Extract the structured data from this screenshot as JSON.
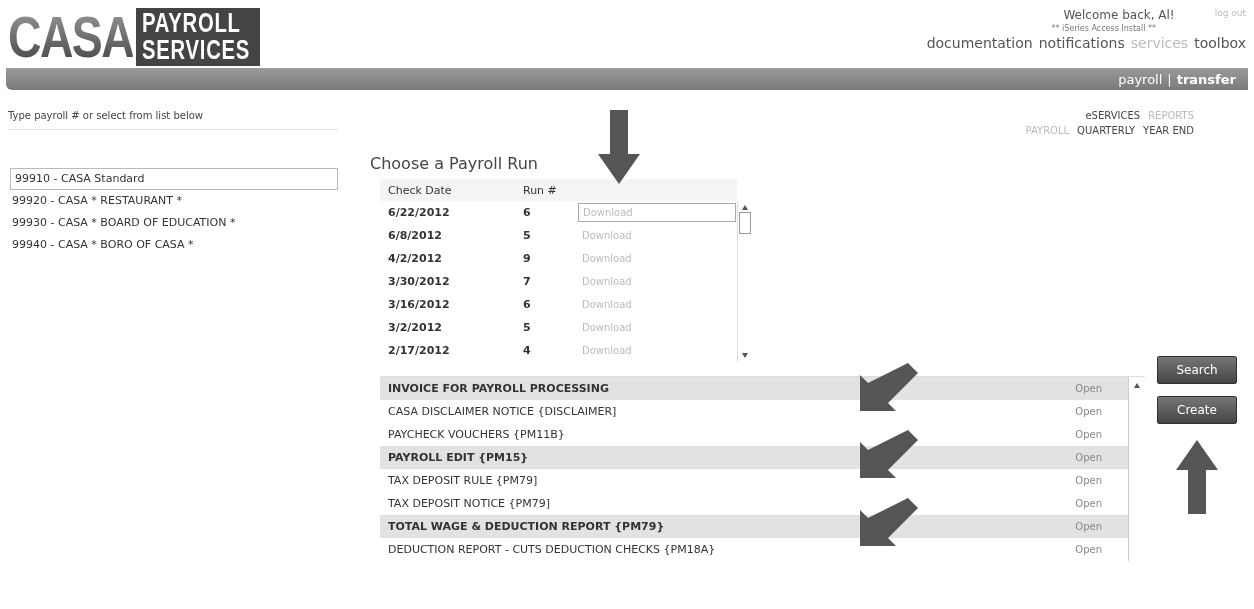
{
  "logo": {
    "word": "CASA",
    "lines": [
      "PAYROLL",
      "SERVICES"
    ]
  },
  "header": {
    "welcome": "Welcome back, Al!",
    "logout": "log out",
    "install": "** iSeries Access Install **",
    "nav": [
      {
        "label": "documentation",
        "selected": false
      },
      {
        "label": "notifications",
        "selected": false
      },
      {
        "label": "services",
        "selected": true
      },
      {
        "label": "toolbox",
        "selected": false
      }
    ]
  },
  "bar": {
    "items": [
      {
        "label": "payroll",
        "selected": false
      },
      {
        "label": "transfer",
        "selected": true
      }
    ],
    "separator": "|"
  },
  "left": {
    "prompt": "Type payroll # or select from list below",
    "payrolls": [
      {
        "label": "99910 - CASA Standard",
        "selected": true
      },
      {
        "label": "99920 - CASA * RESTAURANT *",
        "selected": false
      },
      {
        "label": "99930 - CASA * BOARD OF EDUCATION *",
        "selected": false
      },
      {
        "label": "99940 - CASA * BORO OF CASA *",
        "selected": false
      }
    ]
  },
  "menus": {
    "top": [
      {
        "label": "eSERVICES",
        "selected": false
      },
      {
        "label": "REPORTS",
        "selected": true
      }
    ],
    "sub": [
      {
        "label": "PAYROLL",
        "selected": true
      },
      {
        "label": "QUARTERLY",
        "selected": false
      },
      {
        "label": "YEAR END",
        "selected": false
      }
    ]
  },
  "runs": {
    "title": "Choose a Payroll Run",
    "columns": [
      "Check Date",
      "Run #"
    ],
    "rows": [
      {
        "date": "6/22/2012",
        "run": "6",
        "action": "Download",
        "selected": true
      },
      {
        "date": "6/8/2012",
        "run": "5",
        "action": "Download",
        "selected": false
      },
      {
        "date": "4/2/2012",
        "run": "9",
        "action": "Download",
        "selected": false
      },
      {
        "date": "3/30/2012",
        "run": "7",
        "action": "Download",
        "selected": false
      },
      {
        "date": "3/16/2012",
        "run": "6",
        "action": "Download",
        "selected": false
      },
      {
        "date": "3/2/2012",
        "run": "5",
        "action": "Download",
        "selected": false
      },
      {
        "date": "2/17/2012",
        "run": "4",
        "action": "Download",
        "selected": false
      }
    ]
  },
  "reports": [
    {
      "name": "INVOICE FOR PAYROLL PROCESSING",
      "action": "Open",
      "selected": true
    },
    {
      "name": "CASA DISCLAIMER NOTICE {DISCLAIMER]",
      "action": "Open",
      "selected": false
    },
    {
      "name": "PAYCHECK VOUCHERS {PM11B}",
      "action": "Open",
      "selected": false
    },
    {
      "name": "PAYROLL EDIT {PM15}",
      "action": "Open",
      "selected": true
    },
    {
      "name": "TAX DEPOSIT RULE {PM79]",
      "action": "Open",
      "selected": false
    },
    {
      "name": "TAX DEPOSIT NOTICE {PM79]",
      "action": "Open",
      "selected": false
    },
    {
      "name": "TOTAL WAGE & DEDUCTION REPORT {PM79}",
      "action": "Open",
      "selected": true
    },
    {
      "name": "DEDUCTION REPORT - CUTS DEDUCTION CHECKS {PM18A}",
      "action": "Open",
      "selected": false
    }
  ],
  "buttons": [
    "Search",
    "Create"
  ]
}
